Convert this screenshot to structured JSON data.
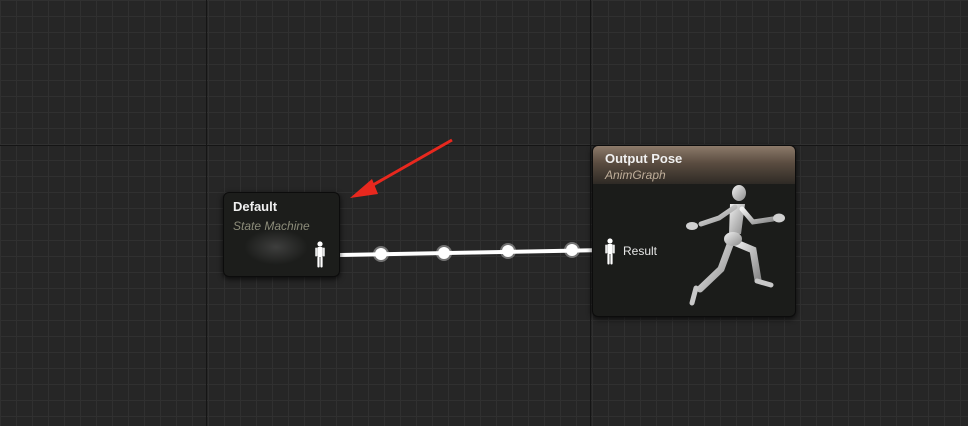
{
  "graph": {
    "nodes": {
      "state_machine": {
        "title": "Default",
        "subtitle": "State Machine",
        "output_pin_icon": "pose-pin-icon"
      },
      "output_pose": {
        "title": "Output Pose",
        "subtitle": "AnimGraph",
        "input_pin_label": "Result",
        "input_pin_icon": "pose-pin-icon",
        "preview_icon": "running-mannequin-icon"
      }
    },
    "connection": {
      "color": "#ffffff"
    },
    "annotation": {
      "icon": "red-arrow-icon",
      "color": "#e8281e"
    },
    "colors": {
      "background": "#262626",
      "header_gradient_top": "#8c7a6a"
    }
  }
}
